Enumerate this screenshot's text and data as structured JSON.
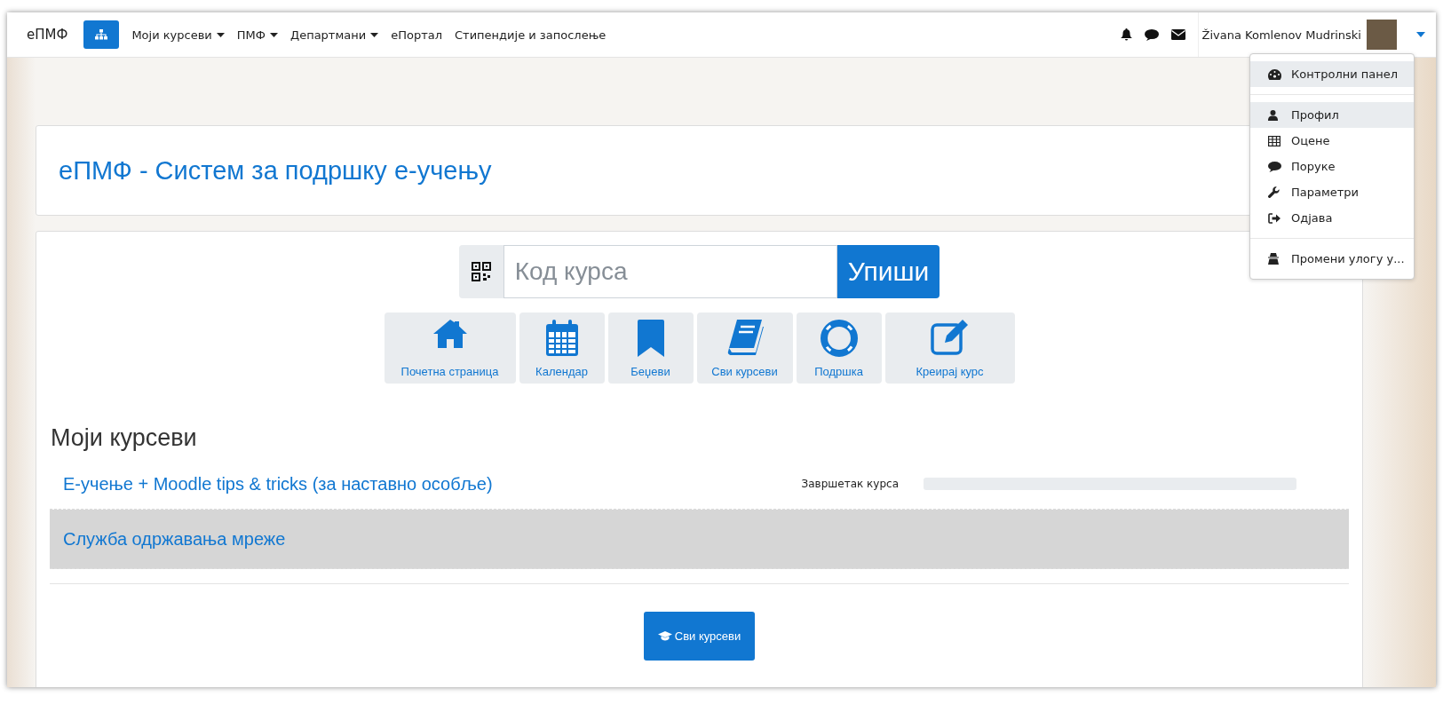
{
  "navbar": {
    "brand": "еПМФ",
    "links": [
      {
        "label": "Моји курсеви",
        "dropdown": true
      },
      {
        "label": "ПМФ",
        "dropdown": true
      },
      {
        "label": "Департмани",
        "dropdown": true
      },
      {
        "label": "еПортал",
        "dropdown": false
      },
      {
        "label": "Стипендије и запослење",
        "dropdown": false
      }
    ],
    "user_name": "Živana Komlenov Mudrinski"
  },
  "user_menu": {
    "expanded": true,
    "sections": [
      [
        {
          "label": "Контролни панел",
          "highlighted": true
        }
      ],
      [
        {
          "label": "Профил",
          "highlighted": true
        },
        {
          "label": "Оцене",
          "highlighted": false
        },
        {
          "label": "Поруке",
          "highlighted": false
        },
        {
          "label": "Параметри",
          "highlighted": false
        },
        {
          "label": "Одјава",
          "highlighted": false
        }
      ],
      [
        {
          "label": "Промени улогу у...",
          "highlighted": false
        }
      ]
    ]
  },
  "header": {
    "title": "еПМФ - Систем за подршку е-учењу"
  },
  "enrol": {
    "placeholder": "Код курса",
    "button": "Упиши"
  },
  "tiles": [
    {
      "label": "Почетна страница"
    },
    {
      "label": "Календар"
    },
    {
      "label": "Беџеви"
    },
    {
      "label": "Сви курсеви"
    },
    {
      "label": "Подршка"
    },
    {
      "label": "Креирај курс"
    }
  ],
  "my_courses": {
    "heading": "Моји курсеви",
    "courses": [
      {
        "name": "Е-учење + Moodle tips & tricks (за наставно особље)",
        "highlighted": false,
        "progress_label": "Завршетак курса",
        "level": 0
      },
      {
        "name": "Служба одржавања мреже",
        "highlighted": true
      }
    ],
    "all_button": "Сви курсеви"
  }
}
